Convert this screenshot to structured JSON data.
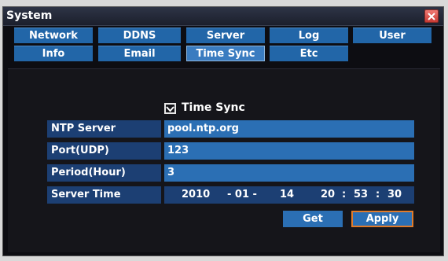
{
  "window": {
    "title": "System"
  },
  "tabs": [
    {
      "label": "Network"
    },
    {
      "label": "DDNS"
    },
    {
      "label": "Server"
    },
    {
      "label": "Log"
    },
    {
      "label": "User"
    },
    {
      "label": "Info"
    },
    {
      "label": "Email"
    },
    {
      "label": "Time Sync"
    },
    {
      "label": "Etc"
    }
  ],
  "active_tab": "Time Sync",
  "time_sync": {
    "checkbox_label": "Time Sync",
    "checked": true,
    "fields": [
      {
        "label": "NTP Server",
        "value": "pool.ntp.org"
      },
      {
        "label": "Port(UDP)",
        "value": "123"
      },
      {
        "label": "Period(Hour)",
        "value": "3"
      }
    ],
    "server_time": {
      "label": "Server Time",
      "year": "2010",
      "sep1": "- 01 -",
      "day": "14",
      "hour": "20",
      "colon1": ":",
      "minute": "53",
      "colon2": ":",
      "second": "30"
    }
  },
  "buttons": {
    "get": "Get",
    "apply": "Apply"
  },
  "colors": {
    "tab_blue": "#2266a8",
    "label_blue": "#1c3f73",
    "field_blue": "#2b6fb4",
    "focus_orange": "#e07b2a",
    "close_red": "#d9463f"
  }
}
